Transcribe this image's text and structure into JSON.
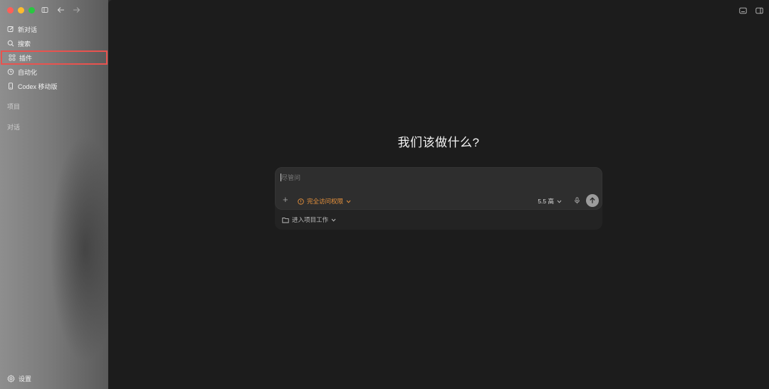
{
  "window": {
    "traffic_lights": [
      "close",
      "minimize",
      "zoom"
    ]
  },
  "sidebar": {
    "items": [
      {
        "label": "新对话",
        "icon": "edit-icon"
      },
      {
        "label": "搜索",
        "icon": "search-icon"
      },
      {
        "label": "插件",
        "icon": "grid-icon",
        "highlighted": true
      },
      {
        "label": "自动化",
        "icon": "clock-icon"
      },
      {
        "label": "Codex 移动版",
        "icon": "phone-icon"
      }
    ],
    "section_projects": "项目",
    "section_chats": "对话",
    "settings_label": "设置"
  },
  "main": {
    "headline": "我们该做什么?",
    "composer": {
      "placeholder": "尽管问",
      "value": "",
      "access_label": "完全访问权限",
      "model_label": "5.5 高",
      "project_label": "进入项目工作"
    }
  },
  "colors": {
    "accent_orange": "#e8923c",
    "highlight_border": "#e8534f",
    "main_bg": "#1c1c1c"
  }
}
